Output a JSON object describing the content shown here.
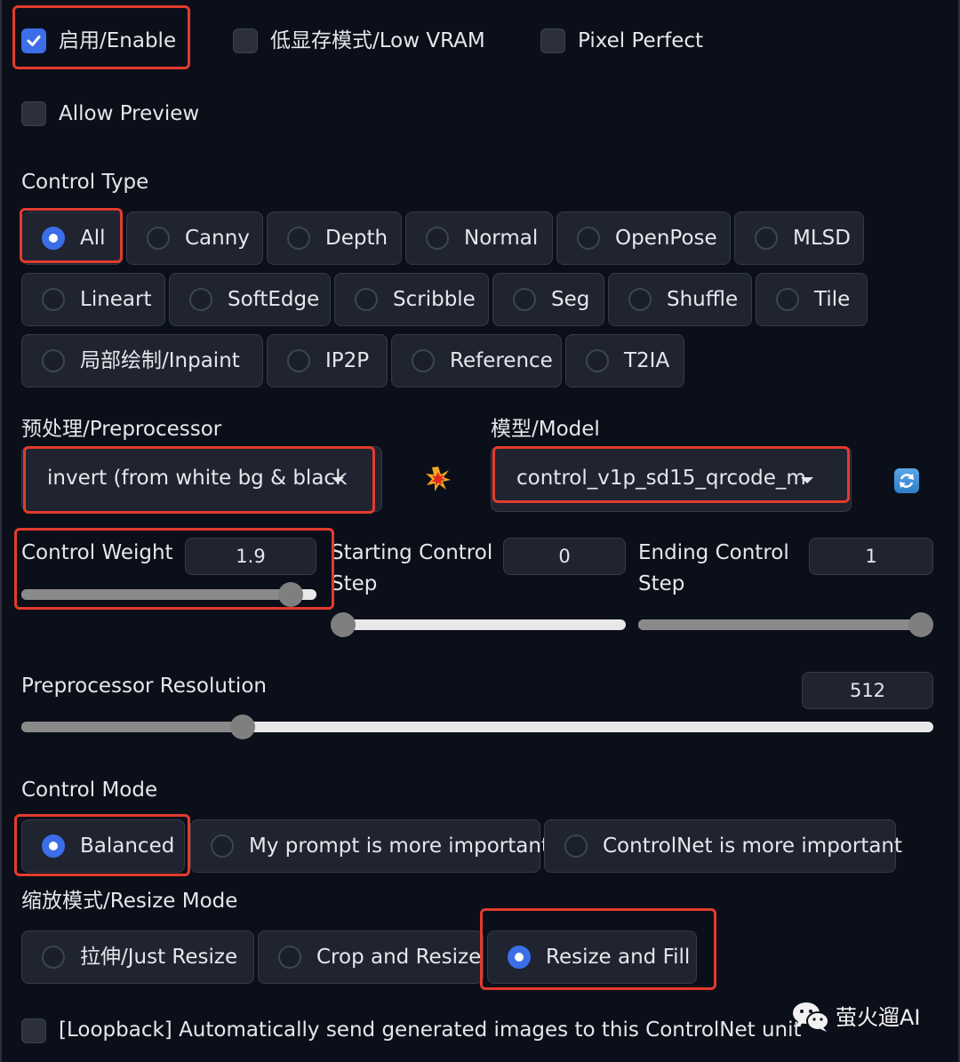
{
  "checkboxes": {
    "enable": {
      "label": "启用/Enable",
      "checked": true
    },
    "low_vram": {
      "label": "低显存模式/Low VRAM",
      "checked": false
    },
    "pixel_perfect": {
      "label": "Pixel Perfect",
      "checked": false
    },
    "allow_preview": {
      "label": "Allow Preview",
      "checked": false
    },
    "loopback": {
      "label": "[Loopback] Automatically send generated images to this ControlNet unit",
      "checked": false
    }
  },
  "control_type": {
    "title": "Control Type",
    "selected": "All",
    "options": [
      "All",
      "Canny",
      "Depth",
      "Normal",
      "OpenPose",
      "MLSD",
      "Lineart",
      "SoftEdge",
      "Scribble",
      "Seg",
      "Shuffle",
      "Tile",
      "局部绘制/Inpaint",
      "IP2P",
      "Reference",
      "T2IA"
    ]
  },
  "preprocessor": {
    "title": "预处理/Preprocessor",
    "value": "invert (from white bg & black"
  },
  "model": {
    "title": "模型/Model",
    "value": "control_v1p_sd15_qrcode_m"
  },
  "icons": {
    "run": "explosion-icon",
    "refresh": "refresh-icon"
  },
  "control_weight": {
    "label": "Control Weight",
    "value": "1.9",
    "fraction": 0.95
  },
  "starting_step": {
    "label_line1": "Starting Control",
    "label_line2": "Step",
    "value": "0",
    "fraction": 0.0
  },
  "ending_step": {
    "label_line1": "Ending Control",
    "label_line2": "Step",
    "value": "1",
    "fraction": 1.0
  },
  "preprocessor_resolution": {
    "label": "Preprocessor Resolution",
    "value": "512",
    "fraction": 0.235
  },
  "control_mode": {
    "title": "Control Mode",
    "selected": "Balanced",
    "options": [
      "Balanced",
      "My prompt is more important",
      "ControlNet is more important"
    ]
  },
  "resize_mode": {
    "title": "缩放模式/Resize Mode",
    "selected": "Resize and Fill",
    "options": [
      "拉伸/Just Resize",
      "Crop and Resize",
      "Resize and Fill"
    ]
  },
  "watermark": {
    "text": "萤火遛AI"
  },
  "colors": {
    "background": "#0b0f19",
    "accent": "#3b6ee8",
    "highlight": "#e33b2e"
  }
}
